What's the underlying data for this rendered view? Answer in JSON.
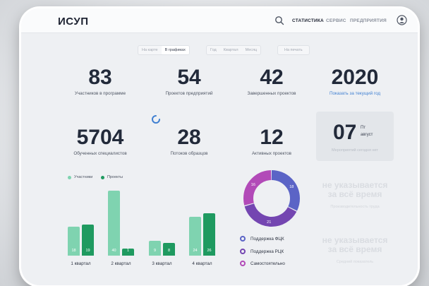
{
  "header": {
    "logo": "ИСУП",
    "nav": [
      "СТАТИСТИКА",
      "СЕРВИС",
      "ПРЕДПРИЯТИЯ"
    ],
    "active_nav": "СТАТИСТИКА"
  },
  "view_toggle": {
    "options": [
      "На карте",
      "В графиках"
    ],
    "selected": "В графиках"
  },
  "period_toggle": {
    "options": [
      "Год",
      "Квартал",
      "Месяц"
    ]
  },
  "print_button": "На печать",
  "stats": {
    "participants": {
      "value": "83",
      "label": "Участников в программе"
    },
    "projects": {
      "value": "54",
      "label": "Проектов предприятий"
    },
    "completed": {
      "value": "42",
      "label": "Завершенных проектов"
    },
    "year": {
      "value": "2020",
      "label": "Показать за текущий год"
    },
    "trained": {
      "value": "5704",
      "label": "Обученных специалистов"
    },
    "flows": {
      "value": "28",
      "label": "Потоков образцов"
    },
    "active": {
      "value": "12",
      "label": "Активных проектов"
    }
  },
  "date_card": {
    "day": "07",
    "weekday": "Пт",
    "month": "август",
    "caption": "Мероприятий сегодня нет"
  },
  "bar_legend": {
    "participants": "Участники",
    "projects": "Проекты"
  },
  "chart_data": {
    "type": "bar",
    "categories": [
      "1 квартал",
      "2 квартал",
      "3 квартал",
      "4 квартал"
    ],
    "series": [
      {
        "name": "Участники",
        "values": [
          18,
          40,
          9,
          24
        ],
        "color": "#7fd3b0"
      },
      {
        "name": "Проекты",
        "values": [
          19,
          1,
          8,
          26
        ],
        "color": "#1f9a60"
      }
    ],
    "ylim": [
      0,
      40
    ]
  },
  "donut": {
    "values": [
      18,
      21,
      16
    ],
    "colors": [
      "#5b64c6",
      "#7446b1",
      "#b24ab8"
    ],
    "legend": [
      "Поддержка ФЦК",
      "Поддержка РЦК",
      "Самостоятельно"
    ]
  },
  "faded_cards": [
    {
      "title_line1": "не указывается",
      "title_line2": "за всё время",
      "caption": "Производительность труда"
    },
    {
      "title_line1": "не указывается",
      "title_line2": "за всё время",
      "caption": "Средний показатель"
    }
  ]
}
